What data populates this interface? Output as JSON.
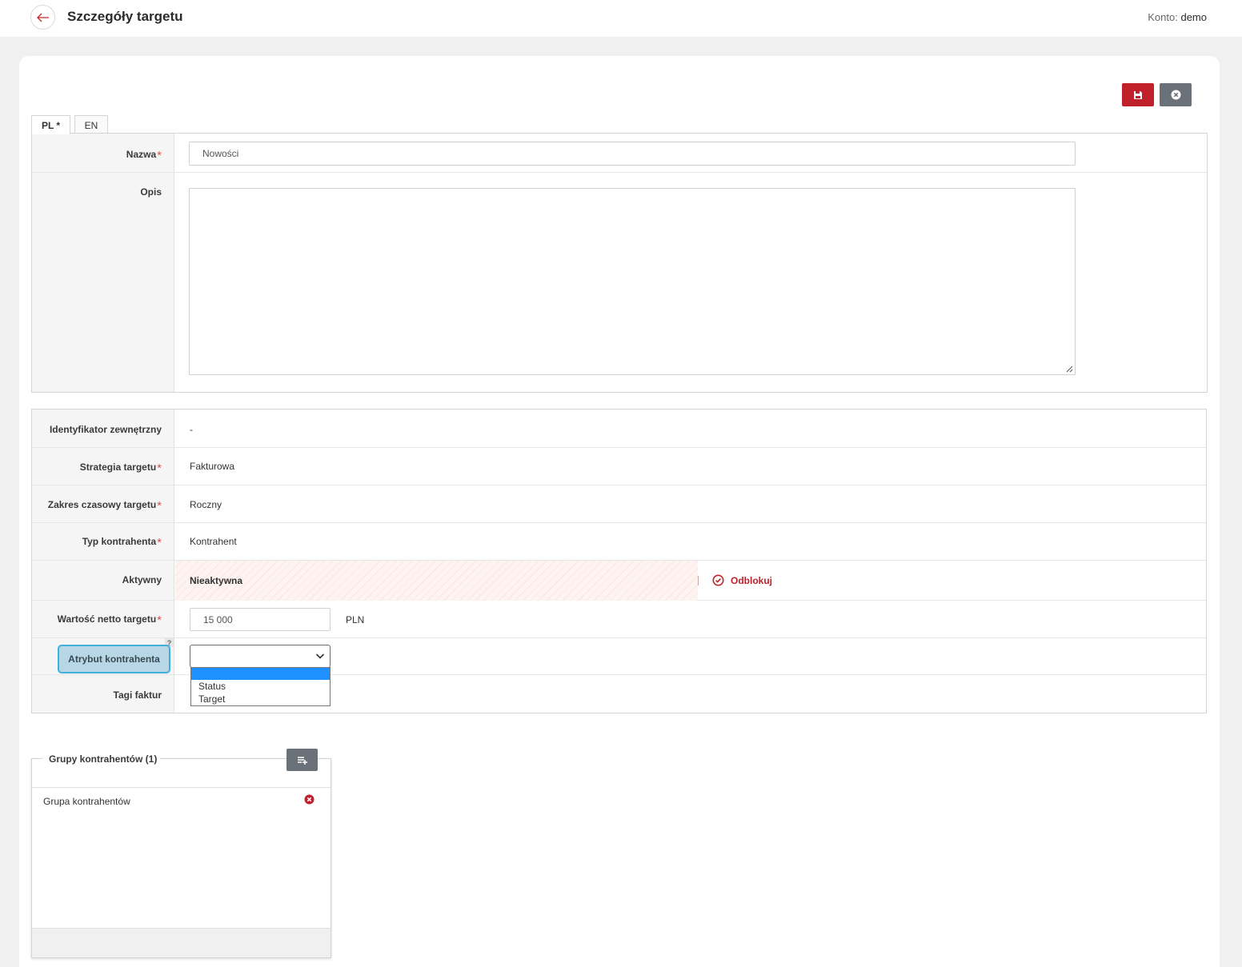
{
  "header": {
    "title": "Szczegóły targetu",
    "account_label": "Konto:",
    "account_value": "demo"
  },
  "tabs": [
    {
      "label": "PL *",
      "active": true
    },
    {
      "label": "EN",
      "active": false
    }
  ],
  "form_lang": {
    "name_label": "Nazwa",
    "name_value": "Nowości",
    "description_label": "Opis",
    "description_value": ""
  },
  "form_main": {
    "external_id_label": "Identyfikator zewnętrzny",
    "external_id_value": "-",
    "strategy_label": "Strategia targetu",
    "strategy_value": "Fakturowa",
    "time_range_label": "Zakres czasowy targetu",
    "time_range_value": "Roczny",
    "contractor_type_label": "Typ kontrahenta",
    "contractor_type_value": "Kontrahent",
    "active_label": "Aktywny",
    "active_value": "Nieaktywna",
    "unlock_label": "Odblokuj",
    "net_value_label": "Wartość netto targetu",
    "net_value": "15 000",
    "currency": "PLN",
    "attribute_label": "Atrybut kontrahenta",
    "help_badge": "?",
    "attribute_selected": "",
    "attribute_options": [
      "",
      "Status",
      "Target"
    ],
    "invoice_tags_label": "Tagi faktur"
  },
  "required_mark": "*",
  "groups": {
    "title": "Grupy kontrahentów (1)",
    "items": [
      "Grupa kontrahentów"
    ]
  },
  "colors": {
    "accent_red": "#c0202a",
    "gray_button": "#6b7178",
    "highlight_blue": "#3fb0de",
    "dropdown_selected": "#1e90ff"
  }
}
